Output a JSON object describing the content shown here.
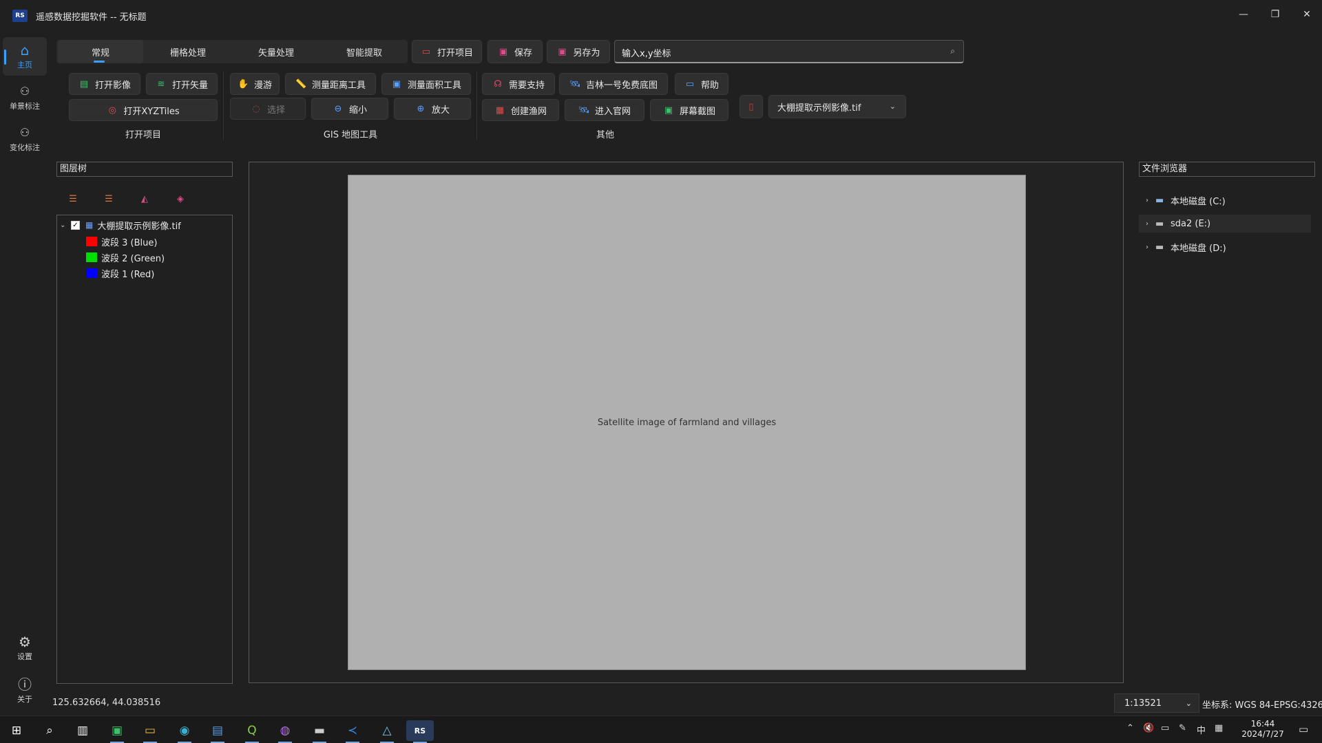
{
  "window": {
    "logo_text": "RS",
    "title": "遥感数据挖掘软件 -- 无标题",
    "minimize": "—",
    "restore": "❐",
    "close": "✕"
  },
  "nav": {
    "items": [
      {
        "label": "主页",
        "icon": "home-icon",
        "glyph": "⌂"
      },
      {
        "label": "单景标注",
        "icon": "users-icon",
        "glyph": "👥"
      },
      {
        "label": "变化标注",
        "icon": "users-change-icon",
        "glyph": "👥"
      }
    ],
    "bottom": [
      {
        "label": "设置",
        "icon": "gear-icon",
        "glyph": "⚙"
      },
      {
        "label": "关于",
        "icon": "info-icon",
        "glyph": "ⓘ"
      }
    ]
  },
  "ribbon": {
    "tabs": [
      "常规",
      "栅格处理",
      "矢量处理",
      "智能提取"
    ],
    "active_tab": "常规",
    "quick": {
      "open_project": "打开项目",
      "save": "保存",
      "save_as": "另存为"
    },
    "search": {
      "placeholder": "输入x,y坐标",
      "value": "输入x,y坐标"
    },
    "open_group": {
      "open_image": "打开影像",
      "open_vector": "打开矢量",
      "open_xyz": "打开XYZTiles",
      "label": "打开项目"
    },
    "gis_group": {
      "roam": "漫游",
      "measure_distance": "测量距离工具",
      "measure_area": "测量面积工具",
      "select": "选择",
      "zoom_out": "缩小",
      "zoom_in": "放大",
      "label": "GIS 地图工具"
    },
    "other_group": {
      "need_support": "需要支持",
      "jilin_basemap": "吉林一号免费底图",
      "help": "帮助",
      "create_fishnet": "创建渔网",
      "visit_site": "进入官网",
      "screenshot": "屏幕截图",
      "label": "其他"
    },
    "image_select": "大棚提取示例影像.tif"
  },
  "layer_tree": {
    "title": "图层树",
    "root": "大棚提取示例影像.tif",
    "bands": [
      {
        "label": "波段 3 (Blue)",
        "color": "#ff0000"
      },
      {
        "label": "波段 2 (Green)",
        "color": "#00e000"
      },
      {
        "label": "波段 1 (Red)",
        "color": "#0000ff"
      }
    ]
  },
  "map": {
    "image_label": "Satellite image of farmland and villages"
  },
  "file_browser": {
    "title": "文件浏览器",
    "drives": [
      "本地磁盘 (C:)",
      "sda2 (E:)",
      "本地磁盘 (D:)"
    ]
  },
  "status": {
    "coords": "125.632664, 44.038516",
    "scale": "1:13521",
    "crs": "坐标系: WGS 84-EPSG:4326"
  },
  "taskbar": {
    "time": "16:44",
    "date": "2024/7/27",
    "ime": "中",
    "apps": [
      "windows-start",
      "search",
      "task-view",
      "pycharm",
      "file-explorer",
      "edge",
      "text-editor",
      "qgis",
      "github-desktop",
      "terminal",
      "vscode",
      "cloud-app",
      "rs-app"
    ]
  }
}
